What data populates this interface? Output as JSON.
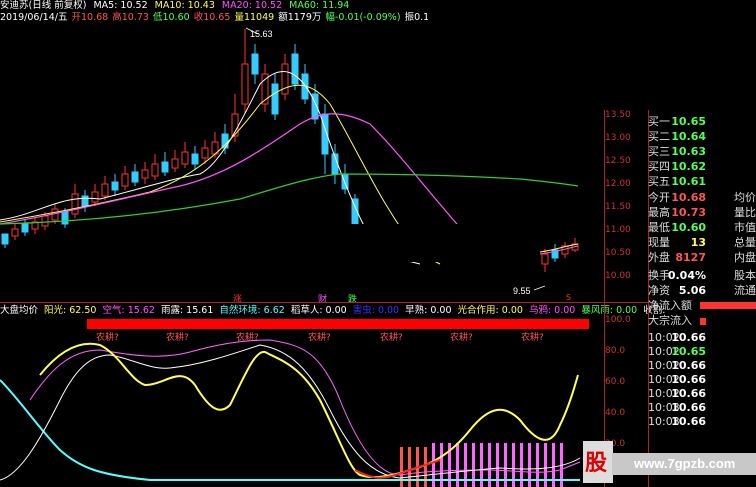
{
  "header": {
    "stock": "安迪苏(日线 前复权)",
    "ma5": "MA5: 10.52",
    "ma10": "MA10: 10.43",
    "ma20": "MA20: 10.52",
    "ma60": "MA60: 11.94",
    "date": "2019/06/14/五",
    "open": "开10.68",
    "high": "高10.73",
    "low": "低10.60",
    "close": "收10.65",
    "vol": "量11049",
    "amount": "额1179万",
    "change": "幅-0.01(-0.09%)",
    "amp": "振0.13(1.22%)",
    "turnover": "换0"
  },
  "chart": {
    "high_label": "15.63",
    "low_label": "9.55",
    "y_ticks": [
      "13.50",
      "13.00",
      "12.50",
      "12.00",
      "11.50",
      "11.00",
      "10.50",
      "10.00"
    ],
    "ind_ticks": [
      "100.0",
      "80.0",
      "60.0",
      "40.0",
      "20.0"
    ],
    "marks": {
      "zhang": "涨",
      "cai": "财",
      "die": "跌",
      "s": "S"
    },
    "nonggeng": "农耕?"
  },
  "indicator": {
    "title": "大盘均价",
    "items": [
      {
        "label": "阳光: 62.50",
        "color": "#ffff55"
      },
      {
        "label": "空气: 15.62",
        "color": "#ff55ff"
      },
      {
        "label": "雨露: 15.61",
        "color": "#ffffff"
      },
      {
        "label": "自然环境: 6.62",
        "color": "#55ffff"
      },
      {
        "label": "稻草人: 0.00",
        "color": "#ffffff"
      },
      {
        "label": "害虫: 0.00",
        "color": "#3333ff"
      },
      {
        "label": "早熟: 0.00",
        "color": "#ffffff"
      },
      {
        "label": "光合作用: 0.00",
        "color": "#ffff55"
      },
      {
        "label": "乌鸦: 0.00",
        "color": "#ff55ff"
      },
      {
        "label": "暴风雨: 0.00",
        "color": "#55ff55"
      },
      {
        "label": "收割:",
        "color": "#ffffff"
      }
    ]
  },
  "quotes": {
    "buy": [
      {
        "label": "买一",
        "value": "10.65",
        "right": ""
      },
      {
        "label": "买二",
        "value": "10.64",
        "right": ""
      },
      {
        "label": "买三",
        "value": "10.63",
        "right": ""
      },
      {
        "label": "买四",
        "value": "10.62",
        "right": ""
      },
      {
        "label": "买五",
        "value": "10.61",
        "right": ""
      }
    ],
    "stats": [
      {
        "label": "今开",
        "value": "10.68",
        "right": "均价",
        "color": "#ff5555"
      },
      {
        "label": "最高",
        "value": "10.73",
        "right": "量比",
        "color": "#ff5555"
      },
      {
        "label": "最低",
        "value": "10.60",
        "right": "市值",
        "color": "#55ff55"
      },
      {
        "label": "现量",
        "value": "13",
        "right": "总量",
        "color": "#ffff55"
      },
      {
        "label": "外盘",
        "value": "8127",
        "right": "内盘",
        "color": "#ff5555"
      },
      {
        "label": "换手",
        "value": "0.04%",
        "right": "股本",
        "color": "#ffffff"
      },
      {
        "label": "净资",
        "value": "5.06",
        "right": "流通",
        "color": "#ffffff"
      }
    ],
    "flow": [
      {
        "label": "净流入额"
      },
      {
        "label": "大宗流入"
      }
    ],
    "ticks": [
      {
        "time": "10:02",
        "price": "10.66",
        "color": "#ffffff"
      },
      {
        "time": "10:02",
        "price": "10.65",
        "color": "#55ff55"
      },
      {
        "time": "10:02",
        "price": "10.66",
        "color": "#ffffff"
      },
      {
        "time": "10:02",
        "price": "10.66",
        "color": "#ffffff"
      },
      {
        "time": "10:02",
        "price": "10.66",
        "color": "#ffffff"
      },
      {
        "time": "10:03",
        "price": "10.66",
        "color": "#ffffff"
      },
      {
        "time": "10:03",
        "price": "10.66",
        "color": "#ffffff"
      }
    ]
  },
  "watermark": {
    "logo": "股",
    "url": "www.7gpzb.com"
  }
}
